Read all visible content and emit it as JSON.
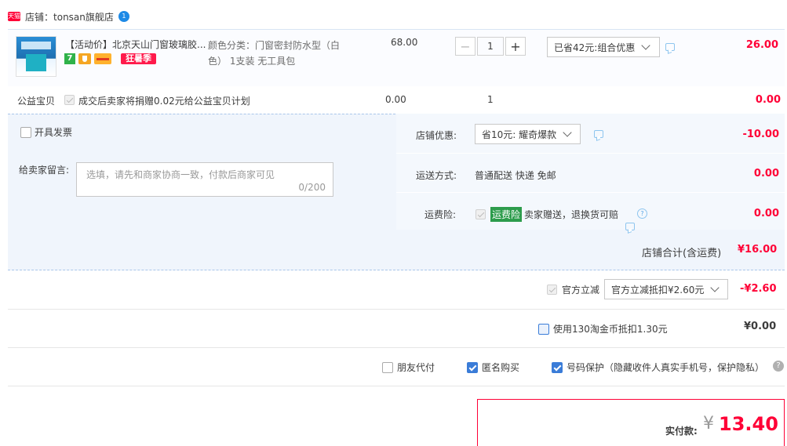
{
  "shop": {
    "label": "店铺：",
    "name": "tonsan旗舰店",
    "badge": "天猫",
    "wangwang": "1"
  },
  "item": {
    "title": "【活动价】北京天山门窗玻璃胶...",
    "sku": "颜色分类：门窗密封防水型（白色） 1支装 无工具包",
    "price": "68.00",
    "qty": "1",
    "discount_select": "已省42元:组合优惠",
    "subtotal": "26.00",
    "promo_tag": "狂暑季",
    "icon_seven": "7"
  },
  "public_welfare": {
    "label": "公益宝贝",
    "text": "成交后卖家将捐赠0.02元给公益宝贝计划",
    "price": "0.00",
    "qty": "1",
    "total": "0.00"
  },
  "invoice": {
    "label": "开具发票"
  },
  "message": {
    "label": "给卖家留言:",
    "placeholder": "选填，请先和商家协商一致，付款后商家可见",
    "counter": "0/200"
  },
  "shop_discount": {
    "label": "店铺优惠:",
    "select": "省10元: 耀奇爆款",
    "value": "-10.00"
  },
  "shipping": {
    "label": "运送方式:",
    "text": "普通配送 快递 免邮",
    "value": "0.00"
  },
  "insurance": {
    "label": "运费险:",
    "tag": "运费险",
    "text": "卖家赠送，退换货可赔",
    "value": "0.00"
  },
  "shop_total": {
    "label": "店铺合计(含运费)",
    "value": "¥16.00"
  },
  "official": {
    "label": "官方立减",
    "select": "官方立减抵扣¥2.60元",
    "value": "-¥2.60"
  },
  "taojinbi": {
    "label": "使用130淘金币抵扣1.30元",
    "value": "¥0.00"
  },
  "options": {
    "friend": "朋友代付",
    "anonymous": "匿名购买",
    "privacy": "号码保护（隐藏收件人真实手机号，保护隐私）"
  },
  "payment": {
    "label": "实付款:",
    "currency": "¥",
    "amount": "13.40"
  },
  "colors": {
    "accent_red": "#ff0036",
    "accent_blue": "#3a7cd8",
    "panel_blue": "#f0f5fc"
  }
}
